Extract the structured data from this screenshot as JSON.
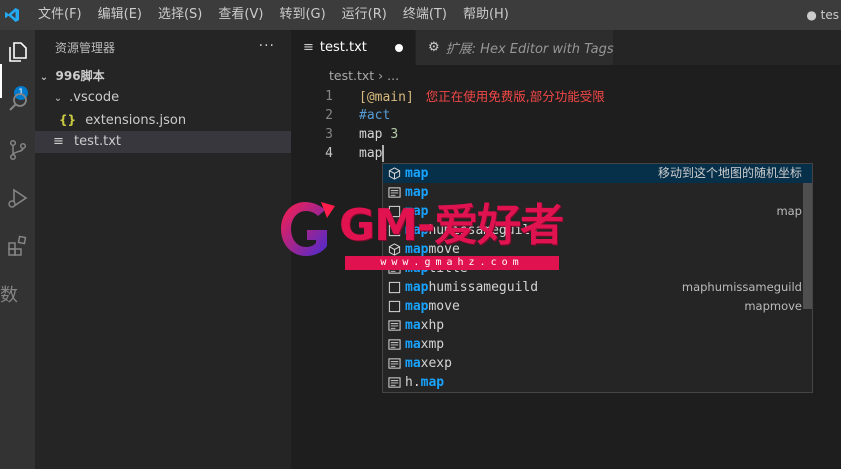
{
  "titlebar": {
    "menus": [
      "文件(F)",
      "编辑(E)",
      "选择(S)",
      "查看(V)",
      "转到(G)",
      "运行(R)",
      "终端(T)",
      "帮助(H)"
    ],
    "right_text": "● tes"
  },
  "activity": {
    "badge": "1",
    "partial_label": "数"
  },
  "sidebar": {
    "title": "资源管理器",
    "more": "···",
    "tree": {
      "root": "996脚本",
      "folder": ".vscode",
      "json_icon": "{}",
      "json_file": "extensions.json",
      "txt_file": "test.txt"
    }
  },
  "editor": {
    "tabs": [
      {
        "label": "test.txt"
      },
      {
        "label": "扩展: Hex Editor with Tags"
      }
    ],
    "breadcrumb": "test.txt › ...",
    "lines": [
      {
        "num": "1",
        "tag": "[@main]",
        "warning": "您正在使用免费版,部分功能受限"
      },
      {
        "num": "2",
        "text": "#act"
      },
      {
        "num": "3",
        "keyword": "map",
        "number": "3"
      },
      {
        "num": "4",
        "text": "map"
      }
    ]
  },
  "suggest": {
    "items": [
      {
        "match": "map",
        "rest": "",
        "detail": "移动到这个地图的随机坐标",
        "icon": "cube"
      },
      {
        "match": "map",
        "rest": "",
        "detail": "",
        "icon": "keyword"
      },
      {
        "match": "map",
        "rest": "",
        "detail": "map",
        "icon": "text"
      },
      {
        "match": "map",
        "rest": "humissameguild",
        "detail": "",
        "icon": "text"
      },
      {
        "match": "map",
        "rest": "move",
        "detail": "",
        "icon": "cube"
      },
      {
        "match": "map",
        "rest": "title",
        "detail": "",
        "icon": "keyword"
      },
      {
        "match": "map",
        "rest": "humissameguild",
        "detail": "maphumissameguild",
        "icon": "text"
      },
      {
        "match": "map",
        "rest": "move",
        "detail": "mapmove",
        "icon": "text"
      },
      {
        "match": "ma",
        "rest": "xhp",
        "detail": "",
        "icon": "keyword"
      },
      {
        "match": "ma",
        "rest": "xmp",
        "detail": "",
        "icon": "keyword"
      },
      {
        "match": "ma",
        "rest": "xexp",
        "detail": "",
        "icon": "keyword"
      },
      {
        "match": "map",
        "rest": "h.",
        "detail": "",
        "icon": "keyword",
        "prefix_first": true
      }
    ]
  },
  "watermark": {
    "text": "GM-爱好者",
    "url": "www.gmahz.com"
  },
  "colors": {
    "accent": "#007acc",
    "watermark": "#e0124f",
    "match": "#18a3ff"
  }
}
